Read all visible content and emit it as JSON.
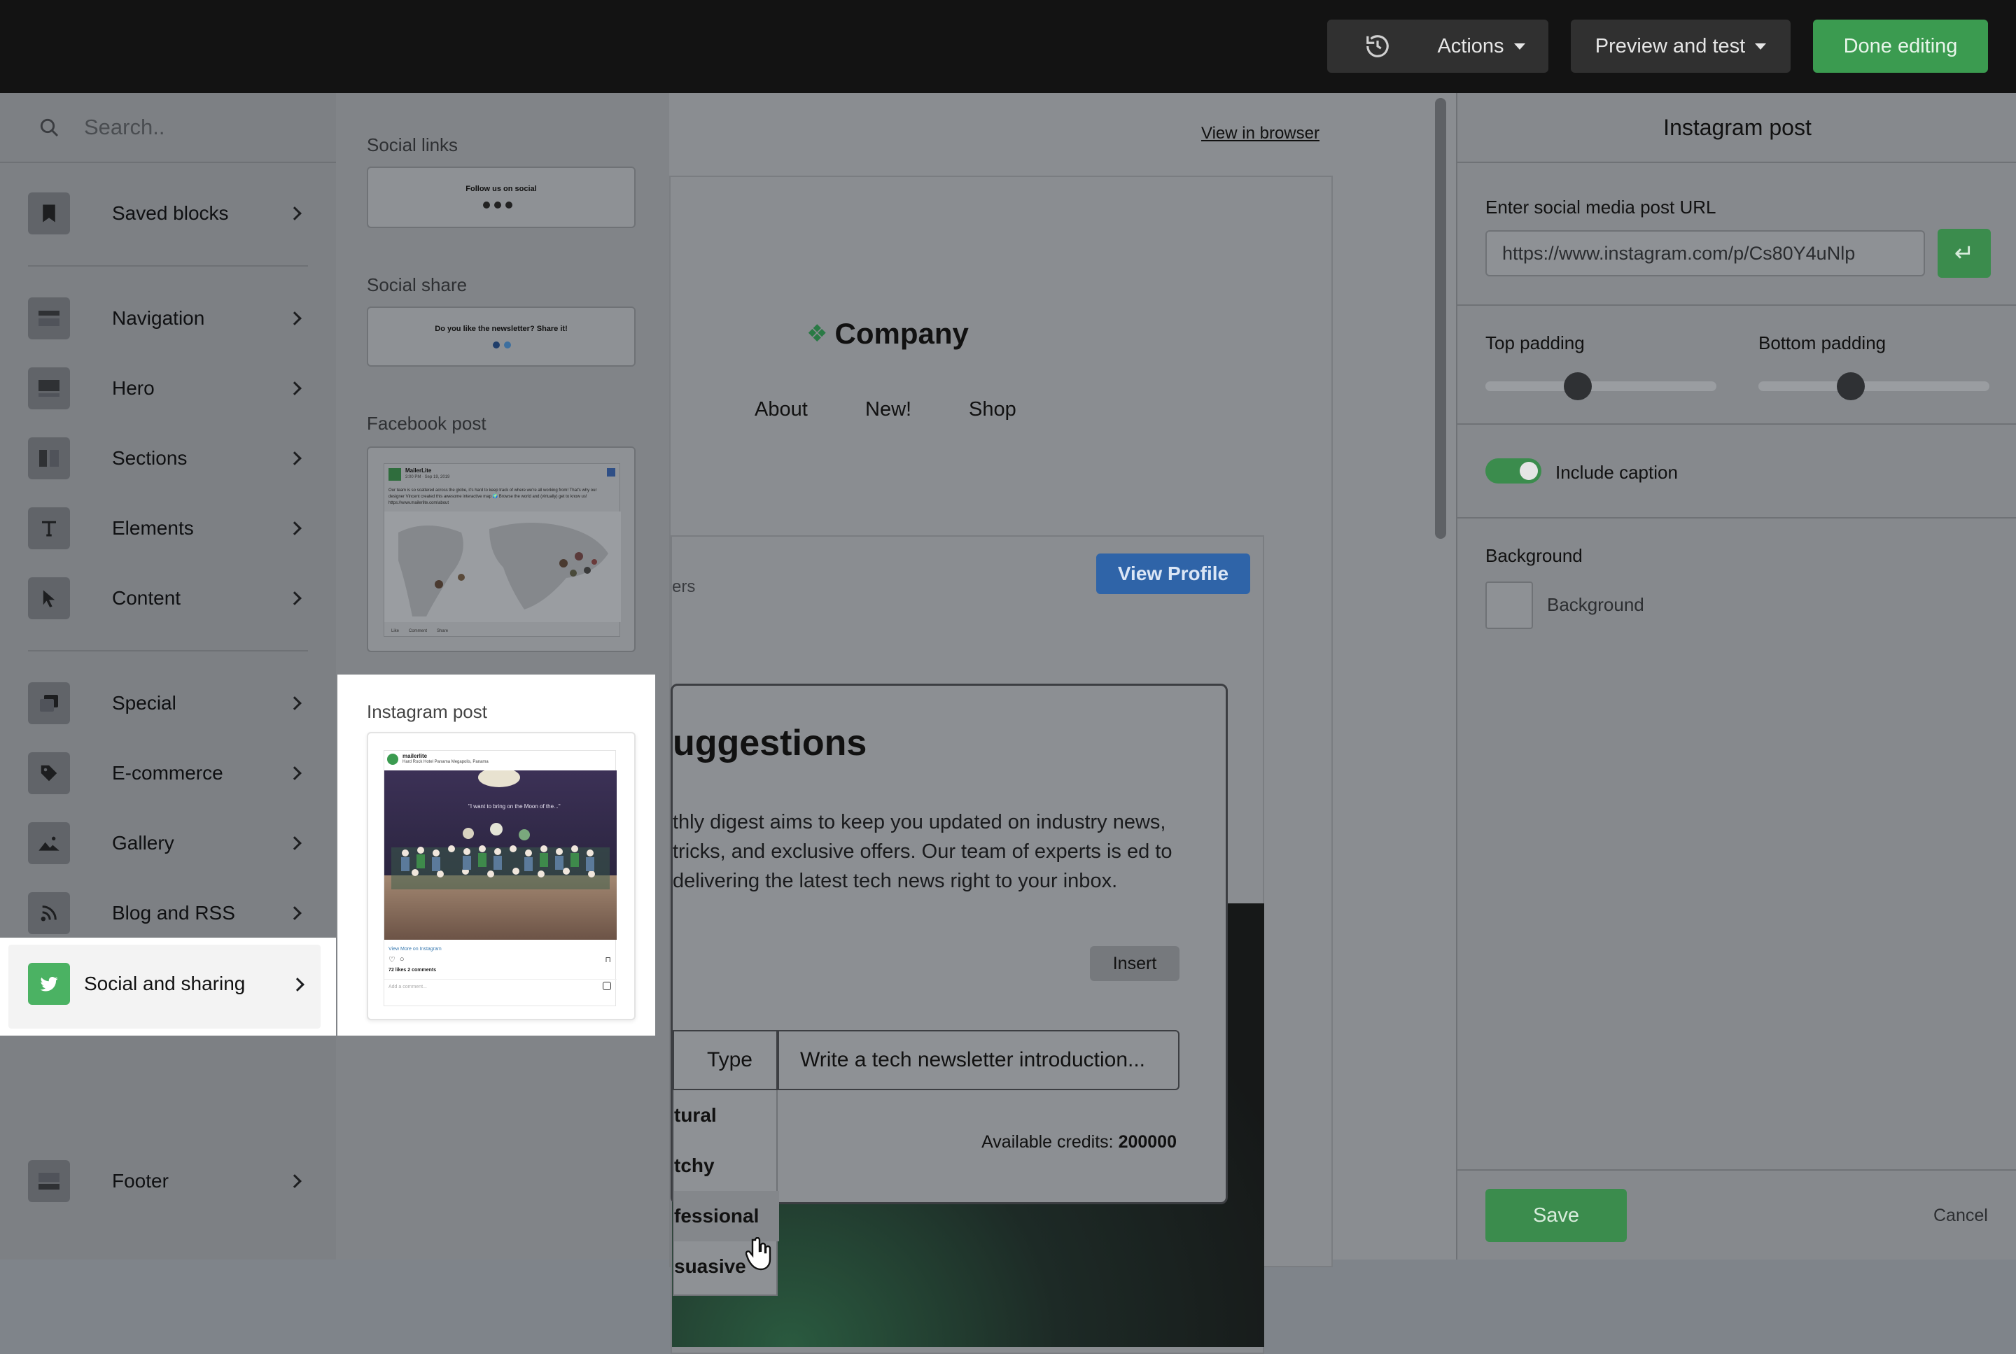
{
  "toolbar": {
    "history_icon": "history-icon",
    "actions_label": "Actions",
    "preview_label": "Preview and test",
    "done_label": "Done editing"
  },
  "sidebar": {
    "search_placeholder": "Search..",
    "items": [
      {
        "label": "Saved blocks",
        "icon": "bookmark-icon"
      },
      {
        "label": "Navigation",
        "icon": "navigation-icon"
      },
      {
        "label": "Hero",
        "icon": "hero-icon"
      },
      {
        "label": "Sections",
        "icon": "sections-icon"
      },
      {
        "label": "Elements",
        "icon": "text-icon"
      },
      {
        "label": "Content",
        "icon": "cursor-icon"
      },
      {
        "label": "Special",
        "icon": "special-icon"
      },
      {
        "label": "E-commerce",
        "icon": "tag-icon"
      },
      {
        "label": "Gallery",
        "icon": "image-icon"
      },
      {
        "label": "Blog and RSS",
        "icon": "rss-icon"
      },
      {
        "label": "Social and sharing",
        "icon": "twitter-icon"
      },
      {
        "label": "Footer",
        "icon": "footer-icon"
      }
    ]
  },
  "blocks": {
    "social_links": {
      "title": "Social links",
      "preview_text": "Follow us on social"
    },
    "social_share": {
      "title": "Social share",
      "preview_text": "Do you like the newsletter? Share it!"
    },
    "facebook_post": {
      "title": "Facebook post",
      "author": "MailerLite",
      "date": "3:00 PM · Sep 19, 2019",
      "body": "Our team is so scattered across the globe, it's hard to keep track of where we're all working from! That's why our designer Vincent created this awesome interactive map 🌍 Browse the world and (virtually) get to know us! https://www.mailerlite.com/about",
      "actions": [
        "Like",
        "Comment",
        "Share"
      ]
    },
    "instagram_post": {
      "title": "Instagram post",
      "account": "mailerlite",
      "location": "Hard Rock Hotel Panama Megapolis, Panama",
      "link": "View More on Instagram",
      "stats": "72 likes 2 comments",
      "comment_placeholder": "Add a comment..."
    }
  },
  "canvas": {
    "view_in_browser": "View in browser",
    "company": "Company",
    "nav_links": [
      "About",
      "New!",
      "Shop"
    ],
    "partial_followers": "ers",
    "view_profile": "View Profile",
    "ai": {
      "title": "uggestions",
      "text": "thly digest aims to keep you updated on industry news, tricks, and exclusive offers. Our team of experts is ed to delivering the latest tech news right to your inbox.",
      "insert": "Insert",
      "type_label": "Type",
      "prompt": "Write a tech newsletter introduction...",
      "credits_label": "Available credits:",
      "credits_value": "200000",
      "tone_options": [
        "tural",
        "tchy",
        "fessional",
        "suasive"
      ]
    }
  },
  "panel": {
    "title": "Instagram post",
    "url_label": "Enter social media post URL",
    "url_value": "https://www.instagram.com/p/Cs80Y4uNlp",
    "top_padding_label": "Top padding",
    "top_padding_value": 0.4,
    "bottom_padding_label": "Bottom padding",
    "bottom_padding_value": 0.4,
    "include_caption_label": "Include caption",
    "include_caption": true,
    "background_heading": "Background",
    "background_label": "Background",
    "save": "Save",
    "cancel": "Cancel"
  },
  "colors": {
    "accent_green": "#3b9b50",
    "topbar": "#131313",
    "twitter_green": "#4bb263",
    "view_profile_blue": "#2f64a8"
  }
}
